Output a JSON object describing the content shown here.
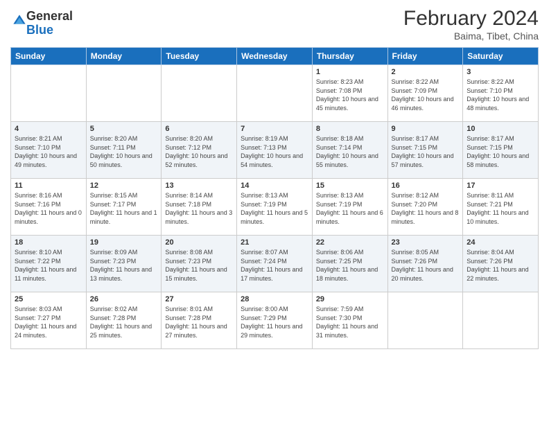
{
  "logo": {
    "general": "General",
    "blue": "Blue"
  },
  "header": {
    "month": "February 2024",
    "location": "Baima, Tibet, China"
  },
  "weekdays": [
    "Sunday",
    "Monday",
    "Tuesday",
    "Wednesday",
    "Thursday",
    "Friday",
    "Saturday"
  ],
  "weeks": [
    [
      {
        "day": "",
        "sunrise": "",
        "sunset": "",
        "daylight": ""
      },
      {
        "day": "",
        "sunrise": "",
        "sunset": "",
        "daylight": ""
      },
      {
        "day": "",
        "sunrise": "",
        "sunset": "",
        "daylight": ""
      },
      {
        "day": "",
        "sunrise": "",
        "sunset": "",
        "daylight": ""
      },
      {
        "day": "1",
        "sunrise": "Sunrise: 8:23 AM",
        "sunset": "Sunset: 7:08 PM",
        "daylight": "Daylight: 10 hours and 45 minutes."
      },
      {
        "day": "2",
        "sunrise": "Sunrise: 8:22 AM",
        "sunset": "Sunset: 7:09 PM",
        "daylight": "Daylight: 10 hours and 46 minutes."
      },
      {
        "day": "3",
        "sunrise": "Sunrise: 8:22 AM",
        "sunset": "Sunset: 7:10 PM",
        "daylight": "Daylight: 10 hours and 48 minutes."
      }
    ],
    [
      {
        "day": "4",
        "sunrise": "Sunrise: 8:21 AM",
        "sunset": "Sunset: 7:10 PM",
        "daylight": "Daylight: 10 hours and 49 minutes."
      },
      {
        "day": "5",
        "sunrise": "Sunrise: 8:20 AM",
        "sunset": "Sunset: 7:11 PM",
        "daylight": "Daylight: 10 hours and 50 minutes."
      },
      {
        "day": "6",
        "sunrise": "Sunrise: 8:20 AM",
        "sunset": "Sunset: 7:12 PM",
        "daylight": "Daylight: 10 hours and 52 minutes."
      },
      {
        "day": "7",
        "sunrise": "Sunrise: 8:19 AM",
        "sunset": "Sunset: 7:13 PM",
        "daylight": "Daylight: 10 hours and 54 minutes."
      },
      {
        "day": "8",
        "sunrise": "Sunrise: 8:18 AM",
        "sunset": "Sunset: 7:14 PM",
        "daylight": "Daylight: 10 hours and 55 minutes."
      },
      {
        "day": "9",
        "sunrise": "Sunrise: 8:17 AM",
        "sunset": "Sunset: 7:15 PM",
        "daylight": "Daylight: 10 hours and 57 minutes."
      },
      {
        "day": "10",
        "sunrise": "Sunrise: 8:17 AM",
        "sunset": "Sunset: 7:15 PM",
        "daylight": "Daylight: 10 hours and 58 minutes."
      }
    ],
    [
      {
        "day": "11",
        "sunrise": "Sunrise: 8:16 AM",
        "sunset": "Sunset: 7:16 PM",
        "daylight": "Daylight: 11 hours and 0 minutes."
      },
      {
        "day": "12",
        "sunrise": "Sunrise: 8:15 AM",
        "sunset": "Sunset: 7:17 PM",
        "daylight": "Daylight: 11 hours and 1 minute."
      },
      {
        "day": "13",
        "sunrise": "Sunrise: 8:14 AM",
        "sunset": "Sunset: 7:18 PM",
        "daylight": "Daylight: 11 hours and 3 minutes."
      },
      {
        "day": "14",
        "sunrise": "Sunrise: 8:13 AM",
        "sunset": "Sunset: 7:19 PM",
        "daylight": "Daylight: 11 hours and 5 minutes."
      },
      {
        "day": "15",
        "sunrise": "Sunrise: 8:13 AM",
        "sunset": "Sunset: 7:19 PM",
        "daylight": "Daylight: 11 hours and 6 minutes."
      },
      {
        "day": "16",
        "sunrise": "Sunrise: 8:12 AM",
        "sunset": "Sunset: 7:20 PM",
        "daylight": "Daylight: 11 hours and 8 minutes."
      },
      {
        "day": "17",
        "sunrise": "Sunrise: 8:11 AM",
        "sunset": "Sunset: 7:21 PM",
        "daylight": "Daylight: 11 hours and 10 minutes."
      }
    ],
    [
      {
        "day": "18",
        "sunrise": "Sunrise: 8:10 AM",
        "sunset": "Sunset: 7:22 PM",
        "daylight": "Daylight: 11 hours and 11 minutes."
      },
      {
        "day": "19",
        "sunrise": "Sunrise: 8:09 AM",
        "sunset": "Sunset: 7:23 PM",
        "daylight": "Daylight: 11 hours and 13 minutes."
      },
      {
        "day": "20",
        "sunrise": "Sunrise: 8:08 AM",
        "sunset": "Sunset: 7:23 PM",
        "daylight": "Daylight: 11 hours and 15 minutes."
      },
      {
        "day": "21",
        "sunrise": "Sunrise: 8:07 AM",
        "sunset": "Sunset: 7:24 PM",
        "daylight": "Daylight: 11 hours and 17 minutes."
      },
      {
        "day": "22",
        "sunrise": "Sunrise: 8:06 AM",
        "sunset": "Sunset: 7:25 PM",
        "daylight": "Daylight: 11 hours and 18 minutes."
      },
      {
        "day": "23",
        "sunrise": "Sunrise: 8:05 AM",
        "sunset": "Sunset: 7:26 PM",
        "daylight": "Daylight: 11 hours and 20 minutes."
      },
      {
        "day": "24",
        "sunrise": "Sunrise: 8:04 AM",
        "sunset": "Sunset: 7:26 PM",
        "daylight": "Daylight: 11 hours and 22 minutes."
      }
    ],
    [
      {
        "day": "25",
        "sunrise": "Sunrise: 8:03 AM",
        "sunset": "Sunset: 7:27 PM",
        "daylight": "Daylight: 11 hours and 24 minutes."
      },
      {
        "day": "26",
        "sunrise": "Sunrise: 8:02 AM",
        "sunset": "Sunset: 7:28 PM",
        "daylight": "Daylight: 11 hours and 25 minutes."
      },
      {
        "day": "27",
        "sunrise": "Sunrise: 8:01 AM",
        "sunset": "Sunset: 7:28 PM",
        "daylight": "Daylight: 11 hours and 27 minutes."
      },
      {
        "day": "28",
        "sunrise": "Sunrise: 8:00 AM",
        "sunset": "Sunset: 7:29 PM",
        "daylight": "Daylight: 11 hours and 29 minutes."
      },
      {
        "day": "29",
        "sunrise": "Sunrise: 7:59 AM",
        "sunset": "Sunset: 7:30 PM",
        "daylight": "Daylight: 11 hours and 31 minutes."
      },
      {
        "day": "",
        "sunrise": "",
        "sunset": "",
        "daylight": ""
      },
      {
        "day": "",
        "sunrise": "",
        "sunset": "",
        "daylight": ""
      }
    ]
  ]
}
